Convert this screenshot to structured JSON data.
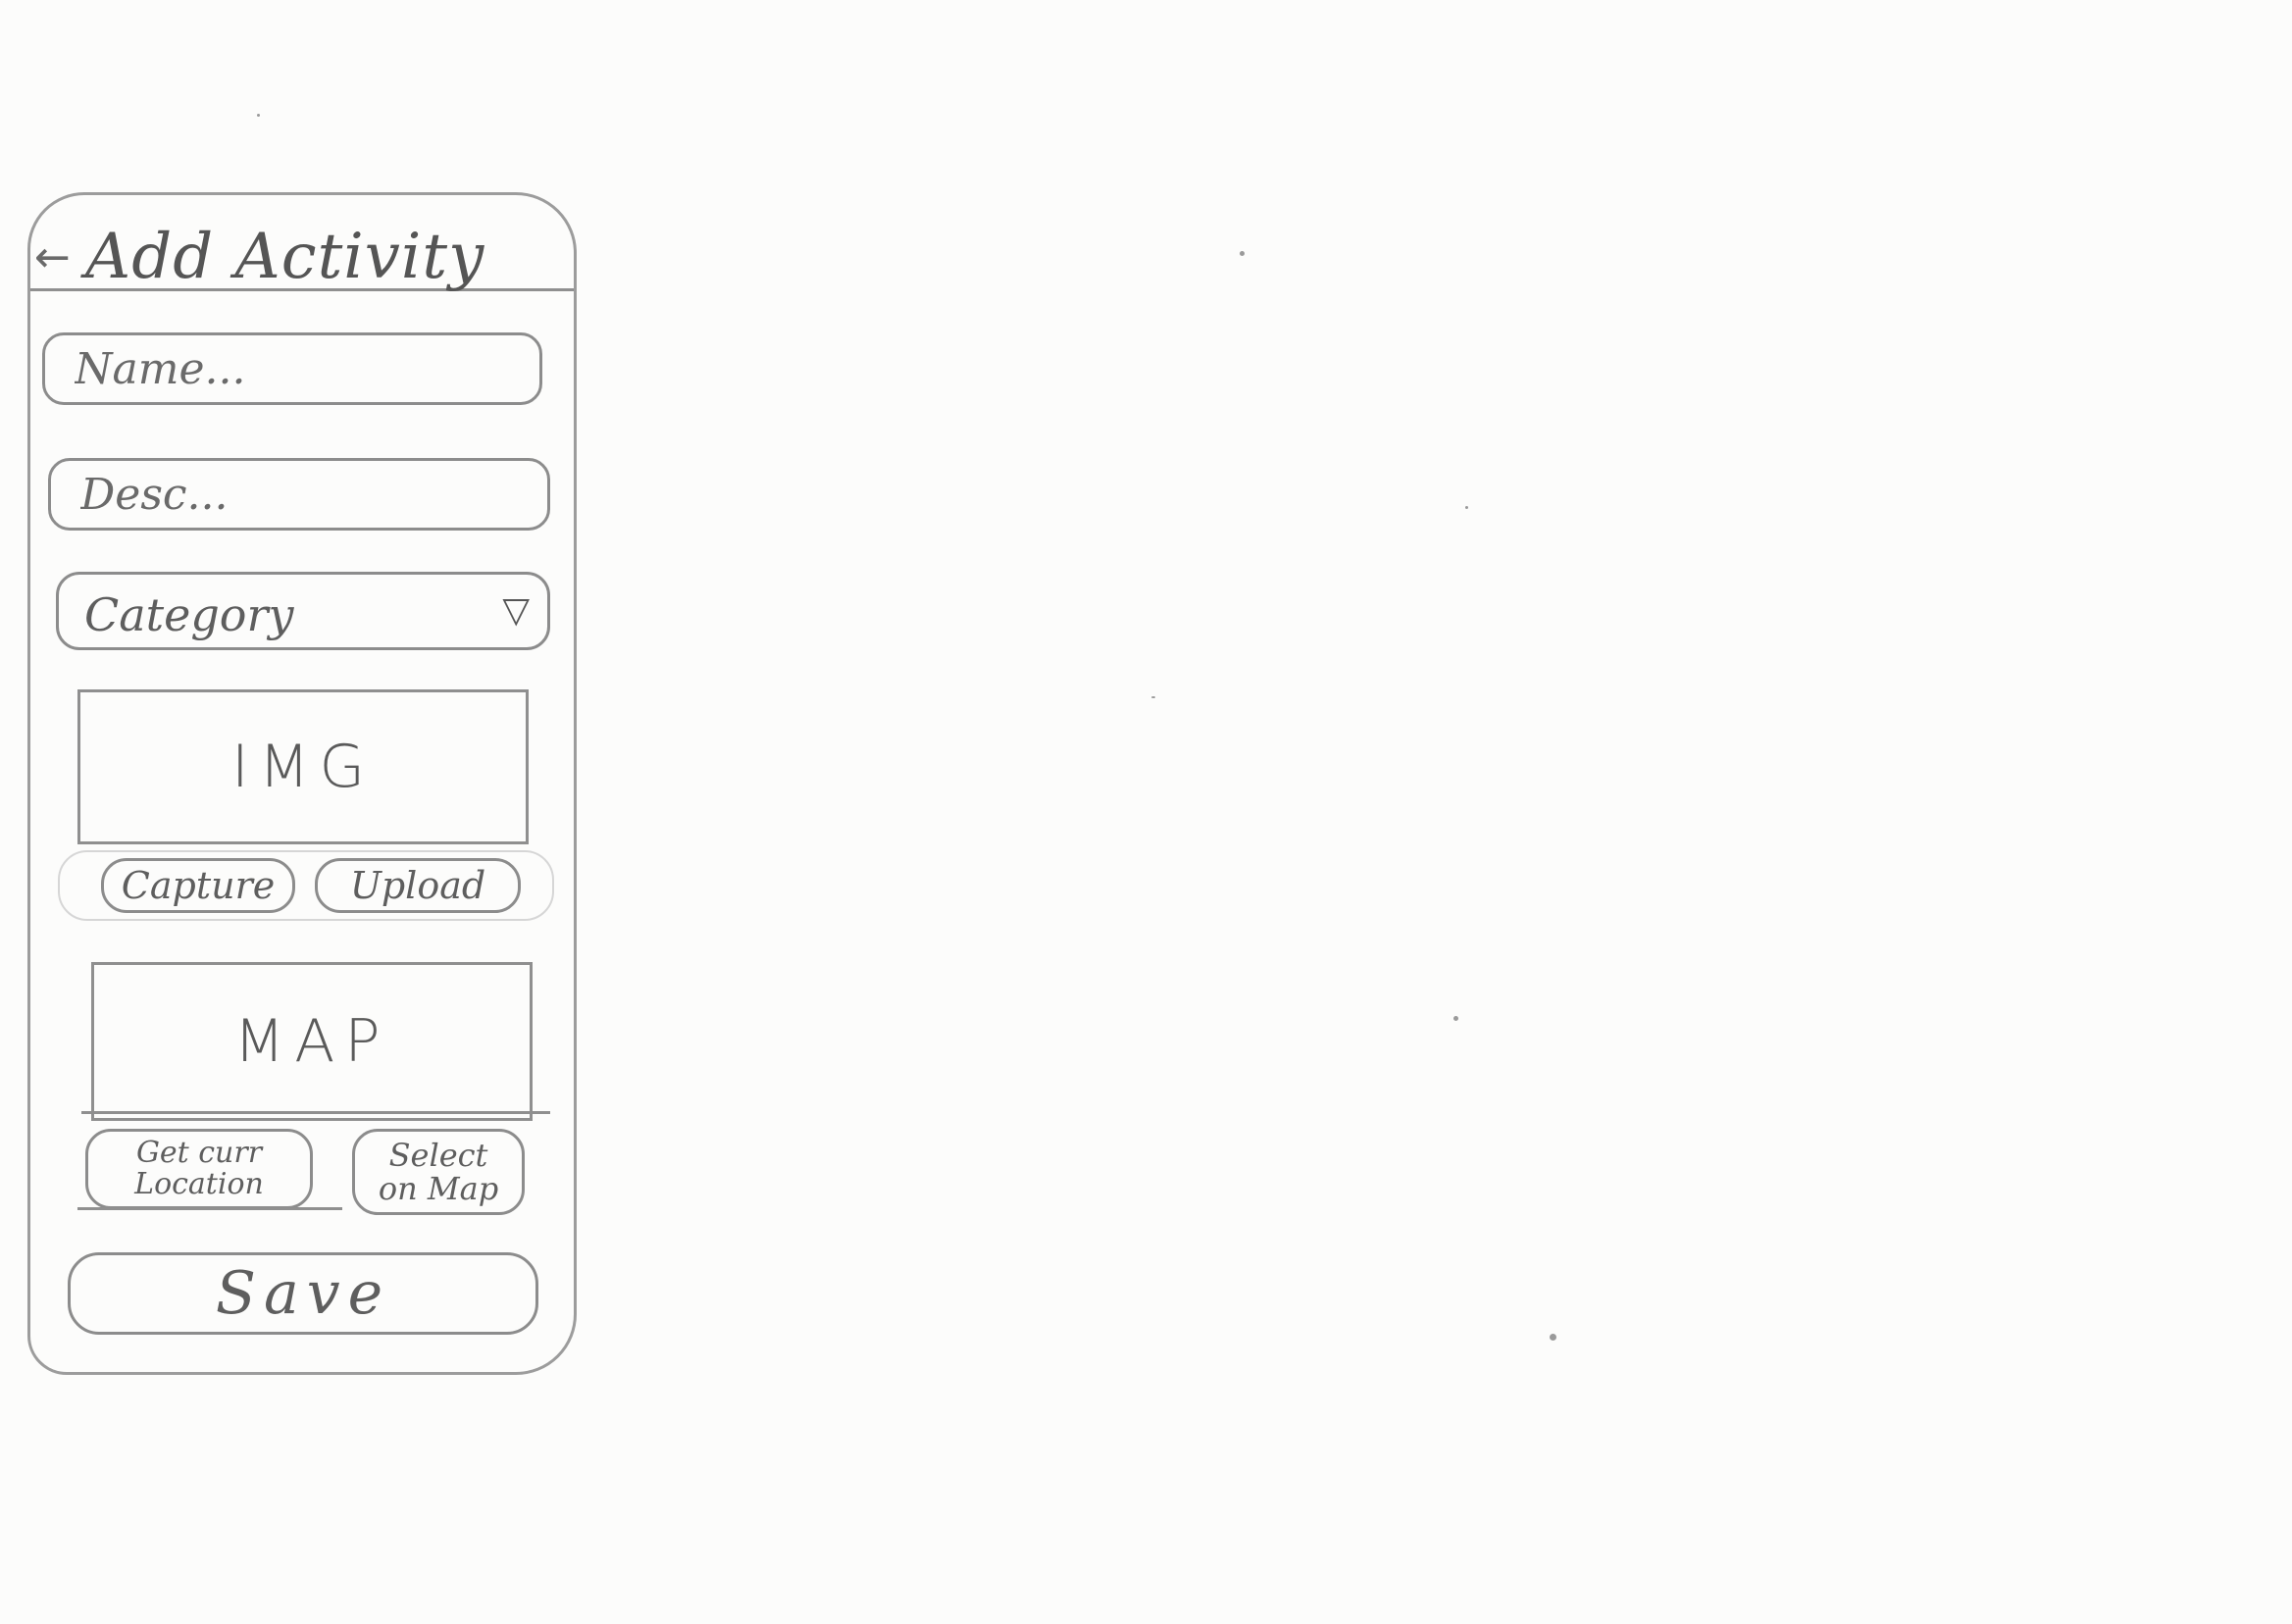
{
  "header": {
    "back_icon": "←",
    "title": "Add Activity"
  },
  "form": {
    "name_placeholder": "Name...",
    "desc_placeholder": "Desc...",
    "category_label": "Category",
    "category_icon": "▽"
  },
  "image": {
    "placeholder_label": "IMG",
    "capture_label": "Capture",
    "upload_label": "Upload"
  },
  "map": {
    "placeholder_label": "MAP",
    "current_location_label": "Get curr\nLocation",
    "select_on_map_label": "Select\non Map"
  },
  "footer": {
    "save_label": "Save"
  },
  "colors": {
    "paper": "#fcfcfb",
    "pencil": "#8c8c8c",
    "text": "#5e5e5e"
  }
}
